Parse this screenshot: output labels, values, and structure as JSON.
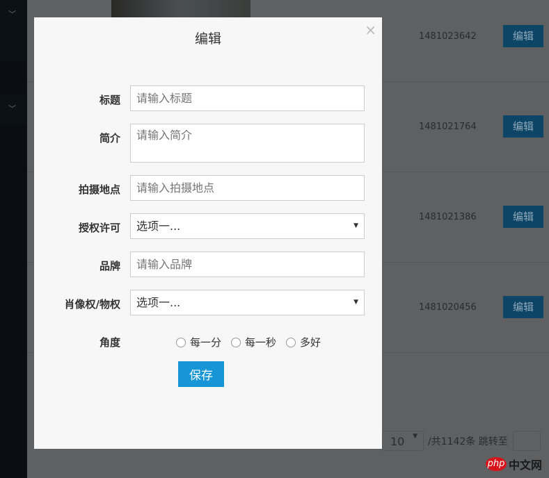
{
  "background": {
    "rows": [
      {
        "id": "1481023642",
        "button": "编辑"
      },
      {
        "id": "1481021764",
        "button": "编辑"
      },
      {
        "id": "1481021386",
        "button": "编辑"
      },
      {
        "id": "1481020456",
        "button": "编辑"
      }
    ],
    "pager": {
      "page_size": "10",
      "total_text": "/共1142条 跳转至"
    }
  },
  "watermark": "php中文网",
  "modal": {
    "title": "编辑",
    "close": "×",
    "fields": [
      {
        "label": "标题",
        "placeholder": "请输入标题"
      },
      {
        "label": "简介",
        "placeholder": "请输入简介"
      },
      {
        "label": "拍摄地点",
        "placeholder": "请输入拍摄地点"
      },
      {
        "label": "授权许可",
        "value": "选项一..."
      },
      {
        "label": "品牌",
        "placeholder": "请输入品牌"
      },
      {
        "label": "肖像权/物权",
        "value": "选项一..."
      }
    ],
    "angle": {
      "label": "角度",
      "options": [
        "每一分",
        "每一秒",
        "多好"
      ]
    },
    "save": "保存"
  }
}
